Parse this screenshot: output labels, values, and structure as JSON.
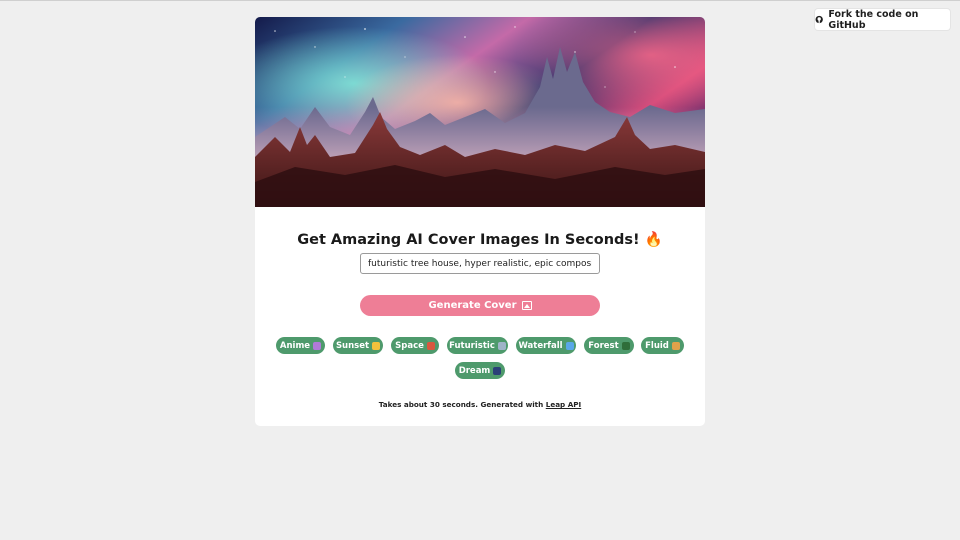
{
  "header": {
    "fork_label": "Fork the code on GitHub"
  },
  "card": {
    "title": "Get Amazing AI Cover Images In Seconds! 🔥",
    "prompt_value": "futuristic tree house, hyper realistic, epic composition, cinematic",
    "generate_label": "Generate Cover",
    "chips": [
      {
        "label": "Anime",
        "icon": "unicorn-icon",
        "color": "#b07ad8"
      },
      {
        "label": "Sunset",
        "icon": "sun-icon",
        "color": "#f4c23c"
      },
      {
        "label": "Space",
        "icon": "rocket-icon",
        "color": "#d9573f"
      },
      {
        "label": "Futuristic",
        "icon": "robot-icon",
        "color": "#9fb3c8"
      },
      {
        "label": "Waterfall",
        "icon": "droplet-icon",
        "color": "#59a7e8"
      },
      {
        "label": "Forest",
        "icon": "tree-icon",
        "color": "#2f6e3a"
      },
      {
        "label": "Fluid",
        "icon": "palette-icon",
        "color": "#e0a24a"
      },
      {
        "label": "Dream",
        "icon": "night-sky-icon",
        "color": "#2b3f78"
      }
    ],
    "footer_text": "Takes about 30 seconds. Generated with ",
    "footer_link": "Leap API"
  },
  "colors": {
    "accent_pink": "#ee7e96",
    "chip_green": "#4e9a6c"
  }
}
